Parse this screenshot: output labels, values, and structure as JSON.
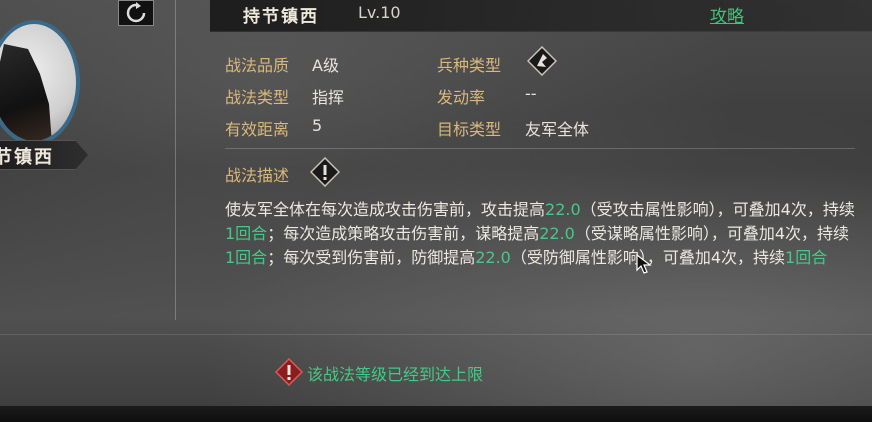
{
  "header": {
    "skill_name": "持节镇西",
    "level": "Lv.10",
    "guide_label": "攻略"
  },
  "portrait": {
    "name": "节镇西"
  },
  "attributes": {
    "quality_label": "战法品质",
    "quality_value": "A级",
    "troop_label": "兵种类型",
    "type_label": "战法类型",
    "type_value": "指挥",
    "trigger_label": "发动率",
    "trigger_value": "--",
    "range_label": "有效距离",
    "range_value": "5",
    "target_label": "目标类型",
    "target_value": "友军全体"
  },
  "description": {
    "title": "战法描述",
    "segments": [
      {
        "t": "使友军全体在每次造成攻击伤害前，攻击提高",
        "h": false
      },
      {
        "t": "22.0",
        "h": true
      },
      {
        "t": "（受攻击属性影响），可叠加4次，持续",
        "h": false
      },
      {
        "t": "1回合",
        "h": true
      },
      {
        "t": "；每次造成策略攻击伤害前，谋略提高",
        "h": false
      },
      {
        "t": "22.0",
        "h": true
      },
      {
        "t": "（受谋略属性影响），可叠加4次，持续",
        "h": false
      },
      {
        "t": "1回合",
        "h": true
      },
      {
        "t": "；每次受到伤害前，防御提高",
        "h": false
      },
      {
        "t": "22.0",
        "h": true
      },
      {
        "t": "（受防御属性影响），可叠加4次，持续",
        "h": false
      },
      {
        "t": "1回合",
        "h": true
      }
    ]
  },
  "footer": {
    "limit_message": "该战法等级已经到达上限"
  },
  "icons": {
    "refresh": "refresh-icon",
    "troop": "troop-type-icon",
    "description": "warning-icon",
    "limit": "warning-icon"
  },
  "colors": {
    "label": "#d9b87a",
    "highlight": "#45c985",
    "link": "#3ec47a"
  }
}
